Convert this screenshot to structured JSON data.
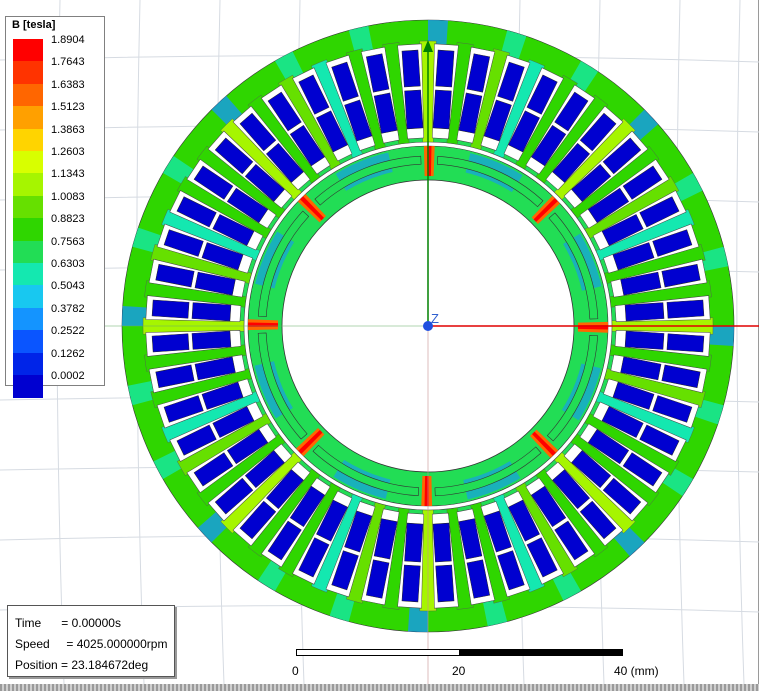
{
  "legend": {
    "title": "B [tesla]",
    "levels": [
      {
        "label": "1.8904",
        "color": "#ff0000"
      },
      {
        "label": "1.7643",
        "color": "#ff3300"
      },
      {
        "label": "1.6383",
        "color": "#ff6600"
      },
      {
        "label": "1.5123",
        "color": "#ffa000"
      },
      {
        "label": "1.3863",
        "color": "#ffd400"
      },
      {
        "label": "1.2603",
        "color": "#d8ff00"
      },
      {
        "label": "1.1343",
        "color": "#a6f500"
      },
      {
        "label": "1.0083",
        "color": "#66e000"
      },
      {
        "label": "0.8823",
        "color": "#2fd600"
      },
      {
        "label": "0.7563",
        "color": "#22dd55"
      },
      {
        "label": "0.6303",
        "color": "#14e8b0"
      },
      {
        "label": "0.5043",
        "color": "#18c8f0"
      },
      {
        "label": "0.3782",
        "color": "#1494ff"
      },
      {
        "label": "0.2522",
        "color": "#0a55ff"
      },
      {
        "label": "0.1262",
        "color": "#0024e8"
      },
      {
        "label": "0.0002",
        "color": "#0000d0"
      }
    ]
  },
  "info": {
    "time": "Time      = 0.00000s",
    "speed": "Speed     = 4025.000000rpm",
    "position": "Position = 23.184672deg"
  },
  "scale_bar": {
    "ticks": [
      "0",
      "20",
      "40 (mm)"
    ]
  },
  "axes": {
    "z_label": "Z"
  },
  "model": {
    "stator_slots": 48,
    "rotor_poles": 8
  }
}
